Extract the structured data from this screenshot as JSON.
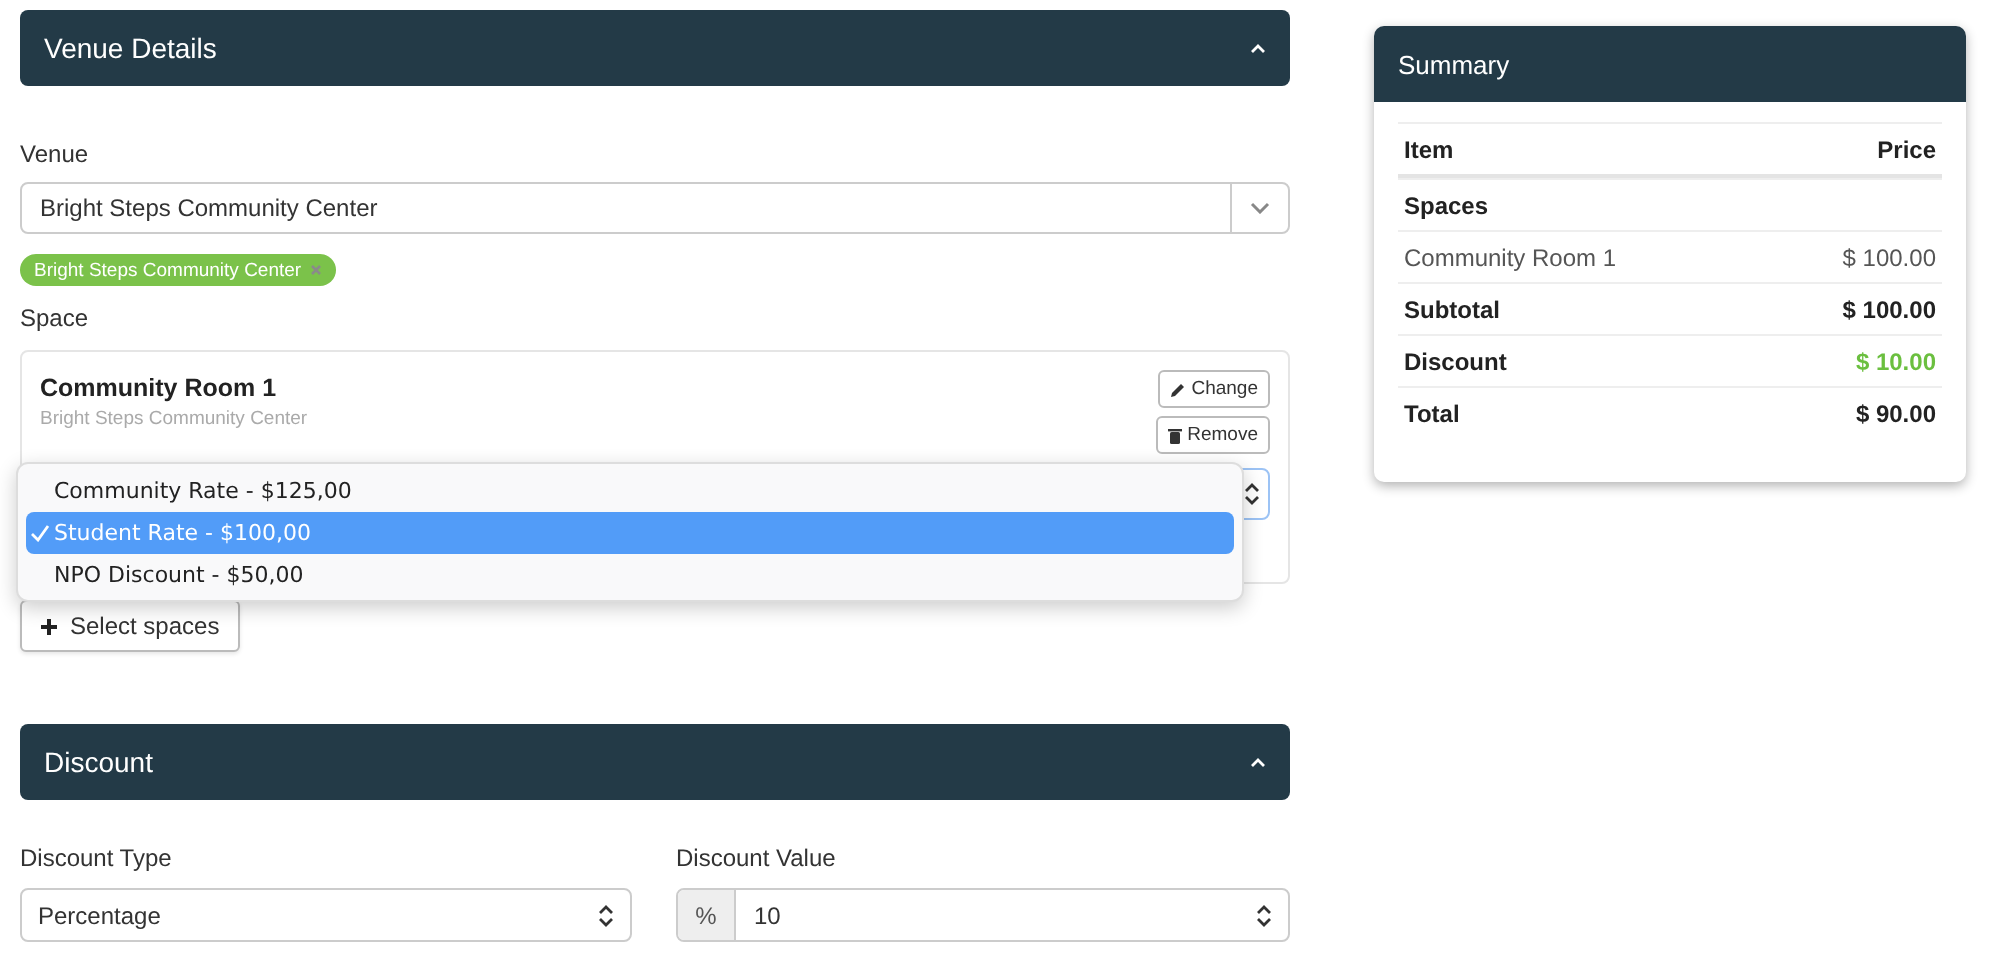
{
  "venue_section": {
    "title": "Venue Details",
    "expanded": true
  },
  "venue": {
    "label": "Venue",
    "value": "Bright Steps Community Center",
    "tags": [
      "Bright Steps Community Center"
    ]
  },
  "space": {
    "label": "Space",
    "title": "Community Room 1",
    "subtitle": "Bright Steps Community Center",
    "buttons": [
      {
        "kind": "edit",
        "label": "Change"
      },
      {
        "kind": "delete",
        "label": "Remove"
      }
    ],
    "rate_options": [
      {
        "label": "Community Rate - $125,00",
        "selected": false
      },
      {
        "label": "Student Rate - $100,00",
        "selected": true
      },
      {
        "label": "NPO Discount - $50,00",
        "selected": false
      }
    ]
  },
  "select_spaces_button": "Select spaces",
  "discount_section": {
    "title": "Discount",
    "expanded": true
  },
  "discount_type": {
    "label": "Discount Type",
    "value": "Percentage"
  },
  "discount_value": {
    "label": "Discount Value",
    "prefix": "%",
    "value": "10"
  },
  "summary": {
    "title": "Summary",
    "columns": [
      "Item",
      "Price"
    ],
    "rows": [
      {
        "kind": "heading",
        "item": "Spaces"
      },
      {
        "kind": "line",
        "item": "Community Room 1",
        "price": "$ 100.00"
      },
      {
        "kind": "total",
        "item": "Subtotal",
        "price": "$ 100.00"
      },
      {
        "kind": "discount",
        "item": "Discount",
        "price": "$ 10.00"
      },
      {
        "kind": "total",
        "item": "Total",
        "price": "$ 90.00"
      }
    ]
  }
}
